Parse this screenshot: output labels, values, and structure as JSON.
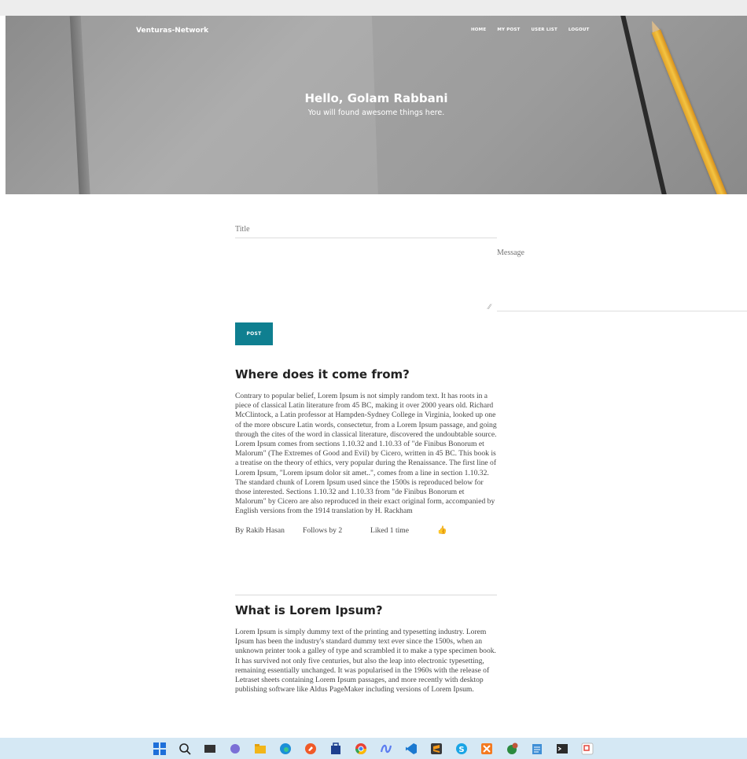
{
  "header": {
    "brand": "Venturas-Network",
    "nav": [
      "HOME",
      "MY POST",
      "USER LIST",
      "LOGOUT"
    ],
    "greeting": "Hello, Golam Rabbani",
    "subtitle": "You will found awesome things here."
  },
  "form": {
    "title_placeholder": "Title",
    "message_placeholder": "Message",
    "post_label": "POST"
  },
  "posts": [
    {
      "title": "Where does it come from?",
      "body": "Contrary to popular belief, Lorem Ipsum is not simply random text. It has roots in a piece of classical Latin literature from 45 BC, making it over 2000 years old. Richard McClintock, a Latin professor at Hampden-Sydney College in Virginia, looked up one of the more obscure Latin words, consectetur, from a Lorem Ipsum passage, and going through the cites of the word in classical literature, discovered the undoubtable source. Lorem Ipsum comes from sections 1.10.32 and 1.10.33 of \"de Finibus Bonorum et Malorum\" (The Extremes of Good and Evil) by Cicero, written in 45 BC. This book is a treatise on the theory of ethics, very popular during the Renaissance. The first line of Lorem Ipsum, \"Lorem ipsum dolor sit amet..\", comes from a line in section 1.10.32. The standard chunk of Lorem Ipsum used since the 1500s is reproduced below for those interested. Sections 1.10.32 and 1.10.33 from \"de Finibus Bonorum et Malorum\" by Cicero are also reproduced in their exact original form, accompanied by English versions from the 1914 translation by H. Rackham",
      "author": "By Rakib Hasan",
      "follows": "Follows by 2",
      "liked": "Liked 1 time"
    },
    {
      "title": "What is Lorem Ipsum?",
      "body": "Lorem Ipsum is simply dummy text of the printing and typesetting industry. Lorem Ipsum has been the industry's standard dummy text ever since the 1500s, when an unknown printer took a galley of type and scrambled it to make a type specimen book. It has survived not only five centuries, but also the leap into electronic typesetting, remaining essentially unchanged. It was popularised in the 1960s with the release of Letraset sheets containing Lorem Ipsum passages, and more recently with desktop publishing software like Aldus PageMaker including versions of Lorem Ipsum."
    }
  ],
  "colors": {
    "accent": "#0f7f90",
    "like": "#1a8d1a",
    "taskbar": "#d5e8f4"
  },
  "taskbar_icons": [
    "windows-start-icon",
    "search-icon",
    "task-view-icon",
    "chat-icon",
    "file-explorer-icon",
    "edge-browser-icon",
    "brave-browser-icon",
    "store-icon",
    "chrome-icon",
    "copilot-icon",
    "vscode-icon",
    "sublime-text-icon",
    "skype-icon",
    "xampp-icon",
    "chrome-profile-icon",
    "notepad-icon",
    "terminal-icon",
    "snipping-tool-icon"
  ]
}
